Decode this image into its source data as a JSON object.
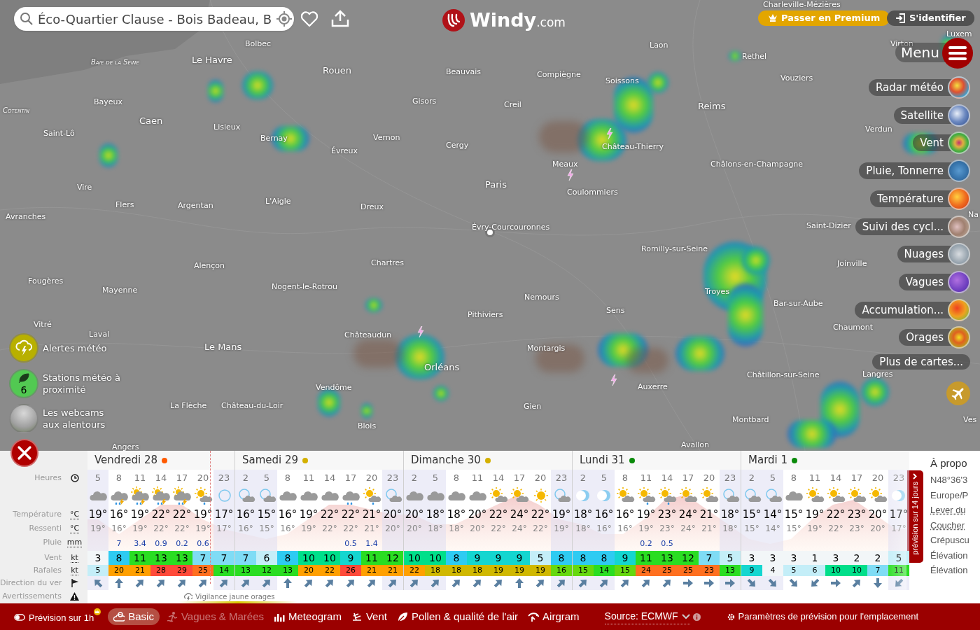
{
  "search": {
    "value": "Éco-Quartier Clause - Bois Badeau, B"
  },
  "logo": {
    "name": "Windy",
    "suffix": ".com"
  },
  "top_buttons": [
    {
      "label": "Passer en Premium",
      "kind": "premium"
    },
    {
      "label": "S'identifier",
      "kind": "login"
    }
  ],
  "map_labels": [
    {
      "text": "Charleville-Mézières",
      "kind": "city"
    },
    {
      "text": "Luxem",
      "kind": "city"
    },
    {
      "text": "Bolbec",
      "kind": "city"
    },
    {
      "text": "Laon",
      "kind": "city"
    },
    {
      "text": "Virton",
      "kind": "city"
    },
    {
      "text": "Baie de la Seine",
      "kind": "region"
    },
    {
      "text": "Le Havre",
      "kind": "major"
    },
    {
      "text": "Rethel",
      "kind": "city"
    },
    {
      "text": "Rouen",
      "kind": "major"
    },
    {
      "text": "Beauvais",
      "kind": "city"
    },
    {
      "text": "Compiègne",
      "kind": "city"
    },
    {
      "text": "Soissons",
      "kind": "city"
    },
    {
      "text": "Vouziers",
      "kind": "city"
    },
    {
      "text": "Cotentin",
      "kind": "region"
    },
    {
      "text": "Bayeux",
      "kind": "city"
    },
    {
      "text": "Gisors",
      "kind": "city"
    },
    {
      "text": "Creil",
      "kind": "city"
    },
    {
      "text": "Reims",
      "kind": "major"
    },
    {
      "text": "Caen",
      "kind": "major"
    },
    {
      "text": "Saint-Lô",
      "kind": "city"
    },
    {
      "text": "Lisieux",
      "kind": "city"
    },
    {
      "text": "Verdun",
      "kind": "city"
    },
    {
      "text": "Bernay",
      "kind": "city"
    },
    {
      "text": "Vernon",
      "kind": "city"
    },
    {
      "text": "Évreux",
      "kind": "city"
    },
    {
      "text": "Cergy",
      "kind": "city"
    },
    {
      "text": "Château-Thierry",
      "kind": "city"
    },
    {
      "text": "Meaux",
      "kind": "city"
    },
    {
      "text": "Châlons-en-Champagne",
      "kind": "city"
    },
    {
      "text": "Vire",
      "kind": "city"
    },
    {
      "text": "Paris",
      "kind": "major"
    },
    {
      "text": "Coulommiers",
      "kind": "city"
    },
    {
      "text": "Flers",
      "kind": "city"
    },
    {
      "text": "Argentan",
      "kind": "city"
    },
    {
      "text": "L'Aigle",
      "kind": "city"
    },
    {
      "text": "Dreux",
      "kind": "city"
    },
    {
      "text": "Avranches",
      "kind": "city"
    },
    {
      "text": "Na",
      "kind": "city"
    },
    {
      "text": "Évry-Courcouronnes",
      "kind": "city"
    },
    {
      "text": "Saint-Dizier",
      "kind": "city"
    },
    {
      "text": "Romilly-sur-Seine",
      "kind": "city"
    },
    {
      "text": "Alençon",
      "kind": "city"
    },
    {
      "text": "Chartres",
      "kind": "city"
    },
    {
      "text": "Joinville",
      "kind": "city"
    },
    {
      "text": "Fougères",
      "kind": "city"
    },
    {
      "text": "Mayenne",
      "kind": "city"
    },
    {
      "text": "Nogent-le-Rotrou",
      "kind": "city"
    },
    {
      "text": "Nemours",
      "kind": "city"
    },
    {
      "text": "Troyes",
      "kind": "city"
    },
    {
      "text": "Bar-sur-Aube",
      "kind": "city"
    },
    {
      "text": "Pithiviers",
      "kind": "city"
    },
    {
      "text": "Sens",
      "kind": "city"
    },
    {
      "text": "Vitré",
      "kind": "city"
    },
    {
      "text": "Chaumont",
      "kind": "city"
    },
    {
      "text": "Laval",
      "kind": "city"
    },
    {
      "text": "Châteaudun",
      "kind": "city"
    },
    {
      "text": "Le Mans",
      "kind": "major"
    },
    {
      "text": "Montargis",
      "kind": "city"
    },
    {
      "text": "Orléans",
      "kind": "major"
    },
    {
      "text": "Châtillon-sur-Seine",
      "kind": "city"
    },
    {
      "text": "Langres",
      "kind": "city"
    },
    {
      "text": "Vendôme",
      "kind": "city"
    },
    {
      "text": "Auxerre",
      "kind": "city"
    },
    {
      "text": "La Flèche",
      "kind": "city"
    },
    {
      "text": "Château-du-Loir",
      "kind": "city"
    },
    {
      "text": "Gien",
      "kind": "city"
    },
    {
      "text": "Blois",
      "kind": "city"
    },
    {
      "text": "Montbard",
      "kind": "city"
    },
    {
      "text": "Ves",
      "kind": "city"
    },
    {
      "text": "Angers",
      "kind": "city"
    },
    {
      "text": "Avallon",
      "kind": "city"
    }
  ],
  "left_panel": [
    {
      "label": "Alertes météo",
      "kind": "alerts"
    },
    {
      "label": "Stations météo à proximité",
      "kind": "stations",
      "count": "6"
    },
    {
      "label": "Les webcams aux alentours",
      "kind": "webcams"
    }
  ],
  "menu": {
    "label": "Menu",
    "layers": [
      "Radar météo",
      "Satellite",
      "Vent",
      "Pluie, Tonnerre",
      "Température",
      "Suivi des cycl...",
      "Nuages",
      "Vagues",
      "Accumulation...",
      "Orages"
    ],
    "more": "Plus de cartes..."
  },
  "forecast": {
    "row_labels": [
      {
        "label": "Heures",
        "kind": "clock"
      },
      {
        "label": "Température",
        "kind": "unit",
        "unit": "°C"
      },
      {
        "label": "Ressenti",
        "kind": "unit",
        "unit": "°C"
      },
      {
        "label": "Pluie",
        "kind": "unit",
        "unit": "mm"
      },
      {
        "label": "Vent",
        "kind": "unit",
        "unit": "kt"
      },
      {
        "label": "Rafales",
        "kind": "unit",
        "unit": "kt"
      },
      {
        "label": "Direction du ver",
        "kind": "flag"
      },
      {
        "label": "Avertissements",
        "kind": "warning"
      }
    ],
    "days": [
      {
        "label": "Vendredi 28",
        "color": "#ff5a00",
        "columns": [
          {
            "hour": "5",
            "kind": "cloudy",
            "temp": "19°",
            "feel": "19°",
            "wind": "3",
            "gust": "5",
            "arrow": {
              "kind": "NW"
            },
            "night": true
          },
          {
            "hour": "8",
            "kind": "thunder-rain",
            "temp": "16°",
            "feel": "16°",
            "rain": "7",
            "wind": "8",
            "gust": "20",
            "arrow": {
              "kind": "N"
            },
            "night": false
          },
          {
            "hour": "11",
            "kind": "sun-thunder-rain",
            "temp": "19°",
            "feel": "19°",
            "rain": "3.4",
            "wind": "11",
            "gust": "21",
            "arrow": {
              "kind": "NE"
            },
            "night": false
          },
          {
            "hour": "14",
            "kind": "sun-thunder-rain",
            "temp": "22°",
            "feel": "22°",
            "rain": "0.9",
            "wind": "13",
            "gust": "28",
            "arrow": {
              "kind": "NE"
            },
            "night": false
          },
          {
            "hour": "17",
            "kind": "sun-thunder-rain",
            "temp": "22°",
            "feel": "22°",
            "rain": "0.2",
            "wind": "13",
            "gust": "29",
            "arrow": {
              "kind": "NE"
            },
            "night": false
          },
          {
            "hour": "20",
            "kind": "sun-rain",
            "temp": "19°",
            "feel": "19°",
            "rain": "0.6",
            "wind": "7",
            "gust": "25",
            "arrow": {
              "kind": "NE"
            },
            "night": false
          },
          {
            "hour": "23",
            "kind": "night-clear",
            "temp": "17°",
            "feel": "17°",
            "wind": "7",
            "gust": "14",
            "arrow": {
              "kind": "NE"
            },
            "night": true
          }
        ]
      },
      {
        "label": "Samedi 29",
        "color": "#d4b000",
        "columns": [
          {
            "hour": "2",
            "kind": "night-cloud",
            "temp": "16°",
            "feel": "16°",
            "wind": "7",
            "gust": "13",
            "arrow": {
              "kind": "NE"
            },
            "night": true
          },
          {
            "hour": "5",
            "kind": "night-cloud",
            "temp": "15°",
            "feel": "15°",
            "wind": "6",
            "gust": "12",
            "arrow": {
              "kind": "NE"
            },
            "night": true
          },
          {
            "hour": "8",
            "kind": "cloudy",
            "temp": "16°",
            "feel": "16°",
            "wind": "8",
            "gust": "13",
            "arrow": {
              "kind": "N"
            },
            "night": false
          },
          {
            "hour": "11",
            "kind": "cloudy",
            "temp": "19°",
            "feel": "19°",
            "wind": "10",
            "gust": "20",
            "arrow": {
              "kind": "NE"
            },
            "night": false
          },
          {
            "hour": "14",
            "kind": "cloudy",
            "temp": "22°",
            "feel": "22°",
            "wind": "10",
            "gust": "22",
            "arrow": {
              "kind": "NE"
            },
            "night": false
          },
          {
            "hour": "17",
            "kind": "rain-cloud",
            "temp": "22°",
            "feel": "22°",
            "rain": "0.5",
            "wind": "9",
            "gust": "26",
            "arrow": {
              "kind": "NE"
            },
            "night": false
          },
          {
            "hour": "20",
            "kind": "sun-rain",
            "temp": "21°",
            "feel": "21°",
            "rain": "1.4",
            "wind": "11",
            "gust": "21",
            "arrow": {
              "kind": "NE"
            },
            "night": false
          },
          {
            "hour": "23",
            "kind": "night-cloud",
            "temp": "20°",
            "feel": "20°",
            "wind": "12",
            "gust": "21",
            "arrow": {
              "kind": "NE"
            },
            "night": true
          }
        ]
      },
      {
        "label": "Dimanche 30",
        "color": "#d4b000",
        "columns": [
          {
            "hour": "2",
            "kind": "cloudy",
            "temp": "20°",
            "feel": "20°",
            "wind": "10",
            "gust": "22",
            "arrow": {
              "kind": "NE"
            },
            "night": true
          },
          {
            "hour": "5",
            "kind": "cloudy",
            "temp": "18°",
            "feel": "18°",
            "wind": "10",
            "gust": "18",
            "arrow": {
              "kind": "NE"
            },
            "night": true
          },
          {
            "hour": "8",
            "kind": "cloudy",
            "temp": "18°",
            "feel": "18°",
            "wind": "8",
            "gust": "18",
            "arrow": {
              "kind": "NE"
            },
            "night": false
          },
          {
            "hour": "11",
            "kind": "cloudy",
            "temp": "20°",
            "feel": "20°",
            "wind": "9",
            "gust": "18",
            "arrow": {
              "kind": "NE"
            },
            "night": false
          },
          {
            "hour": "14",
            "kind": "sun-cloud",
            "temp": "22°",
            "feel": "22°",
            "wind": "9",
            "gust": "19",
            "arrow": {
              "kind": "NE"
            },
            "night": false
          },
          {
            "hour": "17",
            "kind": "sun-cloud",
            "temp": "24°",
            "feel": "24°",
            "wind": "9",
            "gust": "19",
            "arrow": {
              "kind": "N"
            },
            "night": false
          },
          {
            "hour": "20",
            "kind": "sun",
            "temp": "22°",
            "feel": "22°",
            "wind": "5",
            "gust": "19",
            "arrow": {
              "kind": "NE"
            },
            "night": false
          },
          {
            "hour": "23",
            "kind": "night-cloud",
            "temp": "19°",
            "feel": "19°",
            "wind": "8",
            "gust": "16",
            "arrow": {
              "kind": "NE"
            },
            "night": true
          }
        ]
      },
      {
        "label": "Lundi 31",
        "color": "#0a8a0a",
        "columns": [
          {
            "hour": "2",
            "kind": "moon",
            "temp": "18°",
            "feel": "18°",
            "wind": "8",
            "gust": "15",
            "arrow": {
              "kind": "NE"
            },
            "night": true
          },
          {
            "hour": "5",
            "kind": "moon",
            "temp": "16°",
            "feel": "16°",
            "wind": "8",
            "gust": "14",
            "arrow": {
              "kind": "NE"
            },
            "night": true
          },
          {
            "hour": "8",
            "kind": "sun-cloud",
            "temp": "16°",
            "feel": "16°",
            "wind": "9",
            "gust": "15",
            "arrow": {
              "kind": "NE"
            },
            "night": false
          },
          {
            "hour": "11",
            "kind": "sun-rain",
            "temp": "19°",
            "feel": "19°",
            "rain": "0.2",
            "wind": "11",
            "gust": "24",
            "arrow": {
              "kind": "NE"
            },
            "night": false
          },
          {
            "hour": "14",
            "kind": "sun-rain",
            "temp": "23°",
            "feel": "23°",
            "rain": "0.5",
            "wind": "13",
            "gust": "25",
            "arrow": {
              "kind": "NE"
            },
            "night": false
          },
          {
            "hour": "17",
            "kind": "sun-cloud",
            "temp": "24°",
            "feel": "24°",
            "wind": "12",
            "gust": "25",
            "arrow": {
              "kind": "E"
            },
            "night": false
          },
          {
            "hour": "20",
            "kind": "sun-cloud",
            "temp": "21°",
            "feel": "21°",
            "wind": "7",
            "gust": "23",
            "arrow": {
              "kind": "E"
            },
            "night": false
          },
          {
            "hour": "23",
            "kind": "night-cloud",
            "temp": "18°",
            "feel": "18°",
            "wind": "5",
            "gust": "13",
            "arrow": {
              "kind": "E"
            },
            "night": true
          }
        ]
      },
      {
        "label": "Mardi 1",
        "color": "#0a8a0a",
        "columns": [
          {
            "hour": "2",
            "kind": "night-cloud",
            "temp": "15°",
            "feel": "15°",
            "wind": "3",
            "gust": "9",
            "arrow": {
              "kind": "SE"
            },
            "night": true
          },
          {
            "hour": "5",
            "kind": "night-cloud",
            "temp": "14°",
            "feel": "14°",
            "wind": "3",
            "gust": "4",
            "arrow": {
              "kind": "SE"
            },
            "night": true
          },
          {
            "hour": "8",
            "kind": "cloudy",
            "temp": "15°",
            "feel": "15°",
            "wind": "3",
            "gust": "5",
            "arrow": {
              "kind": "SE"
            },
            "night": false
          },
          {
            "hour": "11",
            "kind": "sun-cloud",
            "temp": "19°",
            "feel": "19°",
            "wind": "1",
            "gust": "6",
            "arrow": {
              "kind": "SW"
            },
            "night": false
          },
          {
            "hour": "14",
            "kind": "sun-cloud",
            "temp": "22°",
            "feel": "22°",
            "wind": "3",
            "gust": "10",
            "arrow": {
              "kind": "E"
            },
            "night": false
          },
          {
            "hour": "17",
            "kind": "sun-cloud",
            "temp": "23°",
            "feel": "23°",
            "wind": "2",
            "gust": "10",
            "arrow": {
              "kind": "NE"
            },
            "night": false
          },
          {
            "hour": "20",
            "kind": "sun-cloud",
            "temp": "20°",
            "feel": "20°",
            "wind": "2",
            "gust": "7",
            "arrow": {
              "kind": "S"
            },
            "night": false
          },
          {
            "hour": "23",
            "kind": "moon",
            "temp": "17°",
            "feel": "17°",
            "wind": "5",
            "gust": "11",
            "arrow": {
              "kind": "SW"
            },
            "night": true
          }
        ]
      }
    ],
    "warning": "Vigilance jaune orages",
    "long_forecast": "prévision sur 14 jours"
  },
  "info_panel": [
    "À propo",
    "N48°36'3",
    "Europe/P",
    "Lever du",
    "Coucher",
    "Crépuscu",
    "Élévation",
    "Élévation"
  ],
  "bottom_bar": {
    "items": [
      {
        "label": "Prévision sur 1h",
        "kind": "toggle"
      },
      {
        "label": "Basic",
        "kind": "basic",
        "selected": true,
        "disabled": false
      },
      {
        "label": "Vagues & Marées",
        "kind": "waves",
        "selected": false,
        "disabled": true
      },
      {
        "label": "Meteogram",
        "kind": "meteogram",
        "selected": false,
        "disabled": false
      },
      {
        "label": "Vent",
        "kind": "wind",
        "selected": false,
        "disabled": false
      },
      {
        "label": "Pollen & qualité de l'air",
        "kind": "pollen",
        "selected": false,
        "disabled": false
      },
      {
        "label": "Airgram",
        "kind": "airgram",
        "selected": false,
        "disabled": false
      }
    ],
    "source": "Source: ECMWF",
    "settings": "Paramètres de prévision pour l'emplacement"
  }
}
